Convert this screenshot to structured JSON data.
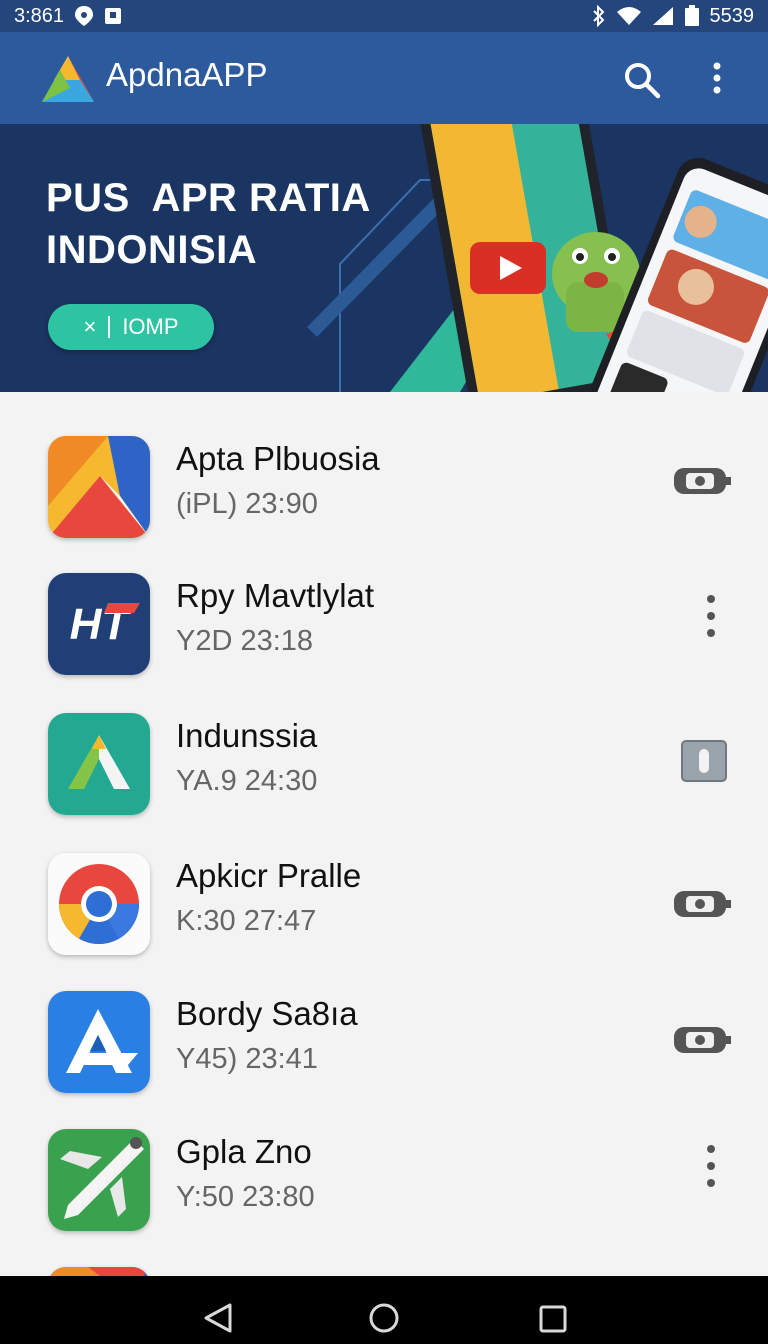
{
  "status_bar": {
    "time": "3:861",
    "battery_text": "5539"
  },
  "app_bar": {
    "title": "ApdnaAPP"
  },
  "banner": {
    "title_line1": "PUS  APR RATIA",
    "title_line2": "INDONISIA",
    "button_icon": "×",
    "button_label": "IOMP"
  },
  "apps": [
    {
      "name": "Apta Plbuosia",
      "meta": "(iPL)  23:90",
      "icon": "multicolor-triangle-app-icon",
      "action": "toggle-icon"
    },
    {
      "name": "Rpy Mavtlylat",
      "meta": "Y2D  23:18",
      "icon": "ht-logo-app-icon",
      "action": "more-vert-icon"
    },
    {
      "name": "Indunssia",
      "meta": "YA.9  24:30",
      "icon": "green-a-app-icon",
      "action": "switch-icon"
    },
    {
      "name": "Apkicr Pralle",
      "meta": "K:30  27:47",
      "icon": "chrome-app-icon",
      "action": "toggle-icon"
    },
    {
      "name": "Bordy Sa8ıa",
      "meta": "Y45)  23:41",
      "icon": "blue-a-app-icon",
      "action": "toggle-icon"
    },
    {
      "name": "Gpla Zno",
      "meta": "Y:50  23:80",
      "icon": "plane-app-icon",
      "action": "more-vert-icon"
    }
  ],
  "colors": {
    "status_bar": "#24467c",
    "app_bar": "#2d5a9c",
    "banner": "#1b3563",
    "accent_button": "#2ec4a3",
    "list_bg": "#f3f3f3"
  }
}
